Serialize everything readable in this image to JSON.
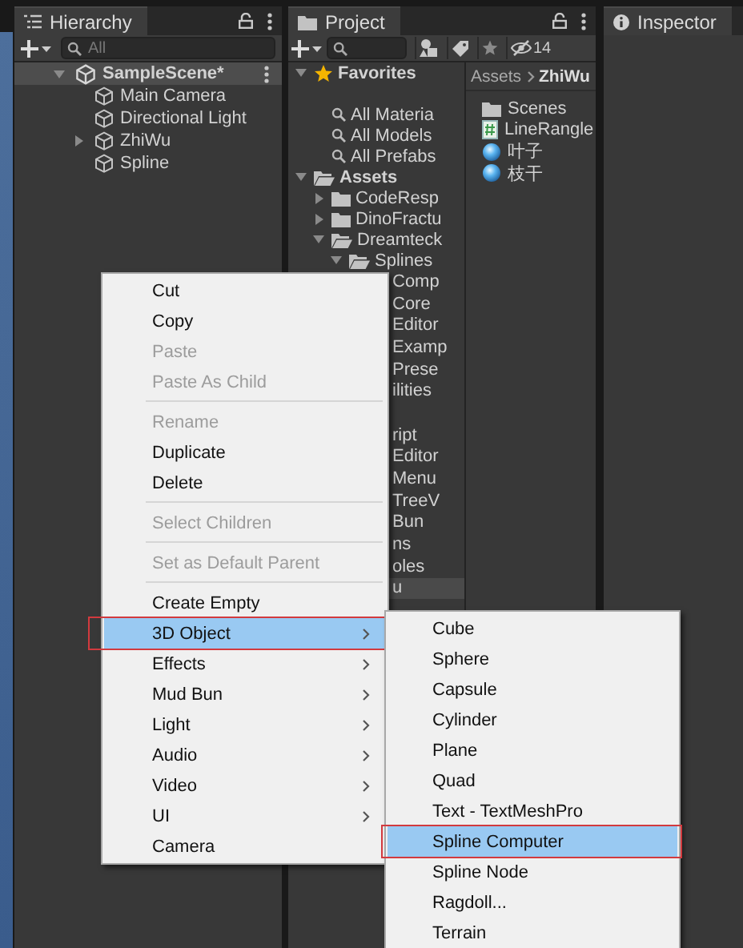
{
  "hierarchy": {
    "tab": "Hierarchy",
    "search": {
      "placeholder": "All"
    },
    "scene": {
      "label": "SampleScene*",
      "expanded": true,
      "selected": true
    },
    "objects": [
      {
        "label": "Main Camera",
        "expandable": false
      },
      {
        "label": "Directional Light",
        "expandable": false
      },
      {
        "label": "ZhiWu",
        "expandable": true
      },
      {
        "label": "Spline",
        "expandable": false
      }
    ]
  },
  "project": {
    "tab": "Project",
    "hidden_count": "14",
    "tree": [
      {
        "kind": "favorites",
        "label": "Favorites",
        "expanded": true,
        "children": [
          {
            "kind": "search",
            "label": "All Materia"
          },
          {
            "kind": "search",
            "label": "All Models"
          },
          {
            "kind": "search",
            "label": "All Prefabs"
          }
        ]
      },
      {
        "kind": "folder",
        "label": "Assets",
        "expanded": true,
        "children": [
          {
            "kind": "folder",
            "label": "CodeResp",
            "expanded": false
          },
          {
            "kind": "folder",
            "label": "DinoFractu",
            "expanded": false
          },
          {
            "kind": "folder",
            "label": "Dreamteck",
            "expanded": true,
            "children": [
              {
                "kind": "folder",
                "label": "Splines",
                "expanded": true
              }
            ]
          }
        ]
      }
    ],
    "covered_rows": [
      {
        "kind": "text",
        "text": "Comp",
        "selected": false
      },
      {
        "kind": "text",
        "text": "Core",
        "selected": false
      },
      {
        "kind": "text",
        "text": "Editor",
        "selected": false
      },
      {
        "kind": "text",
        "text": "Examp",
        "selected": false
      },
      {
        "kind": "text",
        "text": "Prese",
        "selected": false
      },
      {
        "kind": "text",
        "text": "ilities",
        "selected": false
      },
      {
        "kind": "blank"
      },
      {
        "kind": "text",
        "text": "ript",
        "selected": false
      },
      {
        "kind": "text",
        "text": "Editor",
        "selected": false
      },
      {
        "kind": "text",
        "text": "Menu",
        "selected": false
      },
      {
        "kind": "text",
        "text": "TreeV",
        "selected": false
      },
      {
        "kind": "text",
        "text": "Bun",
        "selected": false
      },
      {
        "kind": "text",
        "text": "ns",
        "selected": false
      },
      {
        "kind": "text",
        "text": "oles",
        "selected": false
      },
      {
        "kind": "text",
        "text": "u",
        "selected": true
      }
    ],
    "breadcrumb": [
      "Assets",
      "ZhiWu"
    ],
    "items": [
      {
        "kind": "folder",
        "label": "Scenes"
      },
      {
        "kind": "script",
        "label": "LineRangle"
      },
      {
        "kind": "prefab",
        "label": "叶子"
      },
      {
        "kind": "prefab",
        "label": "枝干"
      }
    ]
  },
  "inspector": {
    "tab": "Inspector"
  },
  "context_menu": {
    "items": [
      {
        "kind": "item",
        "label": "Cut",
        "disabled": false,
        "submenu": false,
        "selected": false,
        "outlined": false
      },
      {
        "kind": "item",
        "label": "Copy",
        "disabled": false,
        "submenu": false,
        "selected": false,
        "outlined": false
      },
      {
        "kind": "item",
        "label": "Paste",
        "disabled": true,
        "submenu": false,
        "selected": false,
        "outlined": false
      },
      {
        "kind": "item",
        "label": "Paste As Child",
        "disabled": true,
        "submenu": false,
        "selected": false,
        "outlined": false
      },
      {
        "kind": "separator"
      },
      {
        "kind": "item",
        "label": "Rename",
        "disabled": true,
        "submenu": false,
        "selected": false,
        "outlined": false
      },
      {
        "kind": "item",
        "label": "Duplicate",
        "disabled": false,
        "submenu": false,
        "selected": false,
        "outlined": false
      },
      {
        "kind": "item",
        "label": "Delete",
        "disabled": false,
        "submenu": false,
        "selected": false,
        "outlined": false
      },
      {
        "kind": "separator"
      },
      {
        "kind": "item",
        "label": "Select Children",
        "disabled": true,
        "submenu": false,
        "selected": false,
        "outlined": false
      },
      {
        "kind": "separator"
      },
      {
        "kind": "item",
        "label": "Set as Default Parent",
        "disabled": true,
        "submenu": false,
        "selected": false,
        "outlined": false
      },
      {
        "kind": "separator"
      },
      {
        "kind": "item",
        "label": "Create Empty",
        "disabled": false,
        "submenu": false,
        "selected": false,
        "outlined": false
      },
      {
        "kind": "item",
        "label": "3D Object",
        "disabled": false,
        "submenu": true,
        "selected": true,
        "outlined": true
      },
      {
        "kind": "item",
        "label": "Effects",
        "disabled": false,
        "submenu": true,
        "selected": false,
        "outlined": false
      },
      {
        "kind": "item",
        "label": "Mud Bun",
        "disabled": false,
        "submenu": true,
        "selected": false,
        "outlined": false
      },
      {
        "kind": "item",
        "label": "Light",
        "disabled": false,
        "submenu": true,
        "selected": false,
        "outlined": false
      },
      {
        "kind": "item",
        "label": "Audio",
        "disabled": false,
        "submenu": true,
        "selected": false,
        "outlined": false
      },
      {
        "kind": "item",
        "label": "Video",
        "disabled": false,
        "submenu": true,
        "selected": false,
        "outlined": false
      },
      {
        "kind": "item",
        "label": "UI",
        "disabled": false,
        "submenu": true,
        "selected": false,
        "outlined": false
      },
      {
        "kind": "item",
        "label": "Camera",
        "disabled": false,
        "submenu": false,
        "selected": false,
        "outlined": false
      }
    ]
  },
  "submenu": {
    "items": [
      {
        "kind": "item",
        "label": "Cube",
        "disabled": false,
        "submenu": false,
        "selected": false,
        "outlined": false
      },
      {
        "kind": "item",
        "label": "Sphere",
        "disabled": false,
        "submenu": false,
        "selected": false,
        "outlined": false
      },
      {
        "kind": "item",
        "label": "Capsule",
        "disabled": false,
        "submenu": false,
        "selected": false,
        "outlined": false
      },
      {
        "kind": "item",
        "label": "Cylinder",
        "disabled": false,
        "submenu": false,
        "selected": false,
        "outlined": false
      },
      {
        "kind": "item",
        "label": "Plane",
        "disabled": false,
        "submenu": false,
        "selected": false,
        "outlined": false
      },
      {
        "kind": "item",
        "label": "Quad",
        "disabled": false,
        "submenu": false,
        "selected": false,
        "outlined": false
      },
      {
        "kind": "item",
        "label": "Text - TextMeshPro",
        "disabled": false,
        "submenu": false,
        "selected": false,
        "outlined": false
      },
      {
        "kind": "item",
        "label": "Spline Computer",
        "disabled": false,
        "submenu": false,
        "selected": true,
        "outlined": true
      },
      {
        "kind": "item",
        "label": "Spline Node",
        "disabled": false,
        "submenu": false,
        "selected": false,
        "outlined": false
      },
      {
        "kind": "item",
        "label": "Ragdoll...",
        "disabled": false,
        "submenu": false,
        "selected": false,
        "outlined": false
      },
      {
        "kind": "item",
        "label": "Terrain",
        "disabled": false,
        "submenu": false,
        "selected": false,
        "outlined": false
      }
    ]
  }
}
